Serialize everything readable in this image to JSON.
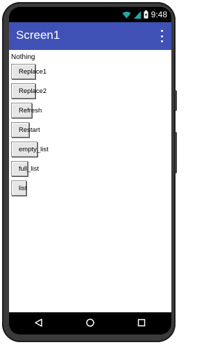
{
  "status_bar": {
    "time": "9:48",
    "icons": [
      "wifi-icon",
      "signal-icon",
      "battery-icon"
    ]
  },
  "app_bar": {
    "title": "Screen1",
    "overflow_icon": "overflow-menu-icon",
    "color": "#3f51b5"
  },
  "content": {
    "label": "Nothing",
    "buttons": [
      {
        "label": "Replace1"
      },
      {
        "label": "Replace2"
      },
      {
        "label": "Refresh"
      },
      {
        "label": "Restart"
      },
      {
        "label": "empty_list"
      },
      {
        "label": "full_list"
      },
      {
        "label": "list"
      }
    ]
  },
  "nav_bar": {
    "icons": [
      "back-icon",
      "home-icon",
      "recents-icon"
    ]
  }
}
